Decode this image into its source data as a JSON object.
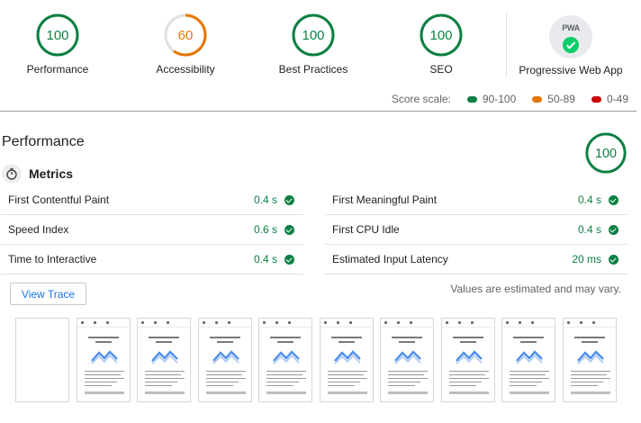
{
  "gauges": [
    {
      "score": "100",
      "label": "Performance",
      "percent": 100,
      "color": "#0b8043",
      "fill": "#ffffff"
    },
    {
      "score": "60",
      "label": "Accessibility",
      "percent": 60,
      "color": "#e67700",
      "fill": "#ffffff"
    },
    {
      "score": "100",
      "label": "Best Practices",
      "percent": 100,
      "color": "#0b8043",
      "fill": "#ffffff"
    },
    {
      "score": "100",
      "label": "SEO",
      "percent": 100,
      "color": "#0b8043",
      "fill": "#ffffff"
    }
  ],
  "pwa": {
    "badge_text": "PWA",
    "label": "Progressive Web App",
    "icon": "pwa-check-icon"
  },
  "score_scale": {
    "label": "Score scale:",
    "ranges": [
      {
        "text": "90-100",
        "color": "#0b8043"
      },
      {
        "text": "50-89",
        "color": "#e67700"
      },
      {
        "text": "0-49",
        "color": "#cc0000"
      }
    ]
  },
  "performance": {
    "title": "Performance",
    "score": "100",
    "percent": 100,
    "metrics_title": "Metrics",
    "metrics_icon": "stopwatch-icon",
    "metrics_left": [
      {
        "label": "First Contentful Paint",
        "value": "0.4 s"
      },
      {
        "label": "Speed Index",
        "value": "0.6 s"
      },
      {
        "label": "Time to Interactive",
        "value": "0.4 s"
      }
    ],
    "metrics_right": [
      {
        "label": "First Meaningful Paint",
        "value": "0.4 s"
      },
      {
        "label": "First CPU Idle",
        "value": "0.4 s"
      },
      {
        "label": "Estimated Input Latency",
        "value": "20 ms"
      }
    ],
    "view_trace": "View Trace",
    "estimate_note": "Values are estimated and may vary."
  },
  "filmstrip": {
    "frame_count": 10,
    "blank_first": true
  }
}
